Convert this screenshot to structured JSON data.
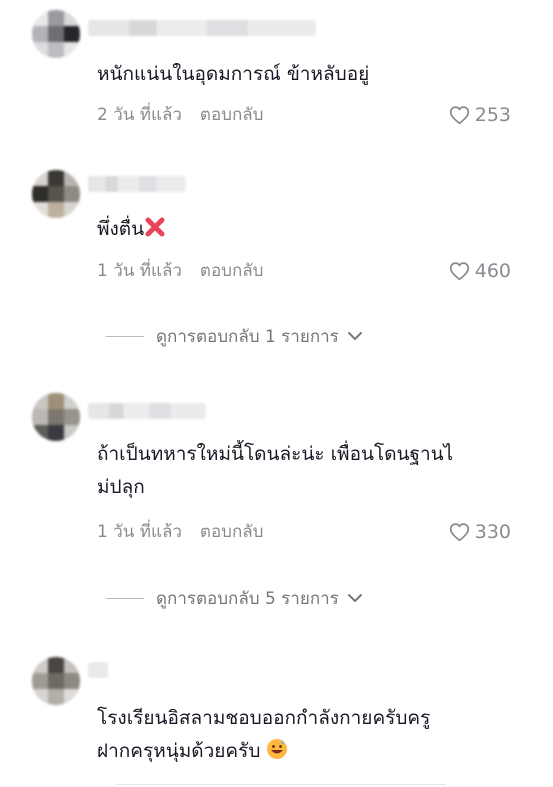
{
  "comments": [
    {
      "text": "หนักแน่นในอุดมการณ์ ข้าหลับอยู่",
      "time": "2 วัน ที่แล้ว",
      "reply": "ตอบกลับ",
      "likes": "253"
    },
    {
      "text": "พึ่งตื่น",
      "emoji": "cross-mark-emoji",
      "time": "1 วัน ที่แล้ว",
      "reply": "ตอบกลับ",
      "likes": "460",
      "view_replies": "ดูการตอบกลับ 1 รายการ"
    },
    {
      "text": "ถ้าเป็นทหารใหม่นี้โดนล่ะน่ะ เพื่อนโดนฐานไ\nม่ปลุก",
      "time": "1 วัน ที่แล้ว",
      "reply": "ตอบกลับ",
      "likes": "330",
      "view_replies": "ดูการตอบกลับ 5 รายการ"
    },
    {
      "text": "โรงเรียนอิสลามชอบออกกำลังกายครับครู\nฝากครุหนุ่มด้วยครับ",
      "emoji": "sweat-smile-emoji"
    }
  ],
  "colors": {
    "text": "#161823",
    "meta": "#8a8b91",
    "cross": "#e8445a"
  }
}
